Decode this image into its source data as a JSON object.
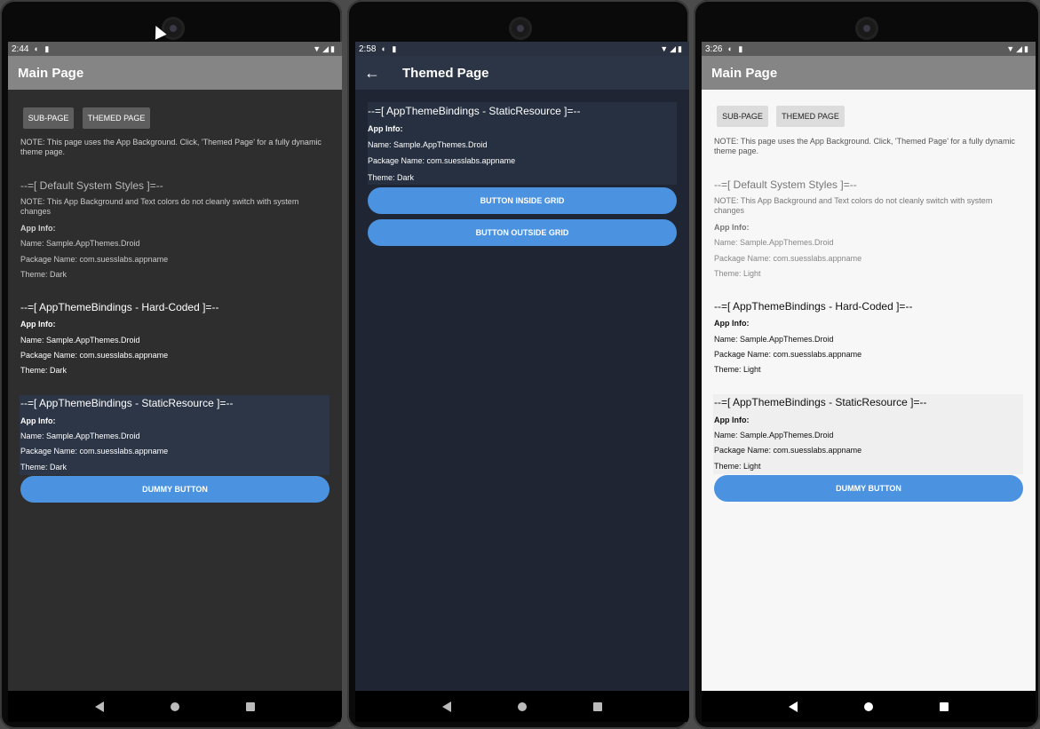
{
  "phones": [
    {
      "status_time": "2:44",
      "title": "Main Page",
      "sub_page_label": "SUB-PAGE",
      "themed_page_label": "THEMED PAGE",
      "note": "NOTE: This page uses the App Background. Click, 'Themed Page' for a fully dynamic theme page.",
      "default_heading": "--=[ Default System Styles ]=--",
      "default_note": "NOTE: This App Background and Text colors do not cleanly switch with system changes",
      "default_app_info": "App Info:",
      "default_name": "Name: Sample.AppThemes.Droid",
      "default_package": "Package Name: com.suesslabs.appname",
      "default_theme": "Theme: Dark",
      "hard_heading": "--=[ AppThemeBindings - Hard-Coded ]=--",
      "hard_app_info": "App Info:",
      "hard_name": "Name: Sample.AppThemes.Droid",
      "hard_package": "Package Name: com.suesslabs.appname",
      "hard_theme": "Theme: Dark",
      "static_heading": "--=[ AppThemeBindings - StaticResource ]=--",
      "static_app_info": "App Info:",
      "static_name": "Name: Sample.AppThemes.Droid",
      "static_package": "Package Name: com.suesslabs.appname",
      "static_theme": "Theme: Dark",
      "dummy_button": "DUMMY BUTTON"
    },
    {
      "status_time": "2:58",
      "back_icon": "arrow-left-icon",
      "title": "Themed Page",
      "static_heading": "--=[ AppThemeBindings - StaticResource ]=--",
      "static_app_info": "App Info:",
      "static_name": "Name: Sample.AppThemes.Droid",
      "static_package": "Package Name: com.suesslabs.appname",
      "static_theme": "Theme: Dark",
      "inside_button": "BUTTON INSIDE GRID",
      "outside_button": "BUTTON OUTSIDE GRID"
    },
    {
      "status_time": "3:26",
      "title": "Main Page",
      "sub_page_label": "SUB-PAGE",
      "themed_page_label": "THEMED PAGE",
      "note": "NOTE: This page uses the App Background. Click, 'Themed Page' for a fully dynamic theme page.",
      "default_heading": "--=[ Default System Styles ]=--",
      "default_note": "NOTE: This App Background and Text colors do not cleanly switch with system changes",
      "default_app_info": "App Info:",
      "default_name": "Name: Sample.AppThemes.Droid",
      "default_package": "Package Name: com.suesslabs.appname",
      "default_theme": "Theme: Light",
      "hard_heading": "--=[ AppThemeBindings - Hard-Coded ]=--",
      "hard_app_info": "App Info:",
      "hard_name": "Name: Sample.AppThemes.Droid",
      "hard_package": "Package Name: com.suesslabs.appname",
      "hard_theme": "Theme: Light",
      "static_heading": "--=[ AppThemeBindings - StaticResource ]=--",
      "static_app_info": "App Info:",
      "static_name": "Name: Sample.AppThemes.Droid",
      "static_package": "Package Name: com.suesslabs.appname",
      "static_theme": "Theme: Light",
      "dummy_button": "DUMMY BUTTON"
    }
  ],
  "colors": {
    "accent_button": "#4b93e0",
    "dark_page_bg": "#2e2e2e",
    "themed_page_bg": "#1f2533",
    "light_page_bg": "#f7f7f7"
  }
}
